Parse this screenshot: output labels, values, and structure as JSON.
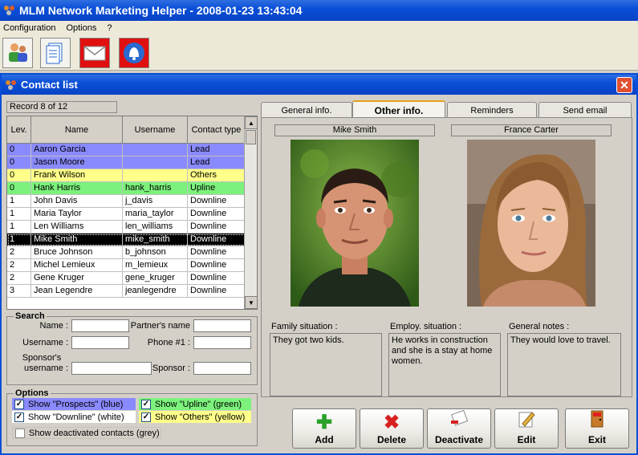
{
  "app": {
    "title": "MLM Network Marketing Helper - 2008-01-23 13:43:04"
  },
  "menu": [
    "Configuration",
    "Options",
    "?"
  ],
  "toolbar": {
    "buttons": [
      "contacts-icon",
      "document-icon",
      "email-icon",
      "alarm-bell-icon"
    ]
  },
  "contact_window": {
    "title": "Contact list",
    "record": "Record 8 of 12",
    "columns": [
      "Lev.",
      "Name",
      "Username",
      "Contact type"
    ],
    "rows": [
      {
        "lev": "0",
        "name": "Aaron Garcia",
        "username": "",
        "type": "Lead",
        "color": "blue"
      },
      {
        "lev": "0",
        "name": "Jason Moore",
        "username": "",
        "type": "Lead",
        "color": "blue"
      },
      {
        "lev": "0",
        "name": "Frank Wilson",
        "username": "",
        "type": "Others",
        "color": "yellow"
      },
      {
        "lev": "0",
        "name": "Hank Harris",
        "username": "hank_harris",
        "type": "Upline",
        "color": "green"
      },
      {
        "lev": "1",
        "name": "John Davis",
        "username": "j_davis",
        "type": "Downline",
        "color": "white"
      },
      {
        "lev": "1",
        "name": "Maria Taylor",
        "username": "maria_taylor",
        "type": "Downline",
        "color": "white"
      },
      {
        "lev": "1",
        "name": "Len Williams",
        "username": "len_williams",
        "type": "Downline",
        "color": "white"
      },
      {
        "lev": "1",
        "name": "Mike Smith",
        "username": "mike_smith",
        "type": "Downline",
        "color": "selected"
      },
      {
        "lev": "2",
        "name": "Bruce Johnson",
        "username": "b_johnson",
        "type": "Downline",
        "color": "white"
      },
      {
        "lev": "2",
        "name": "Michel Lemieux",
        "username": "m_lemieux",
        "type": "Downline",
        "color": "white"
      },
      {
        "lev": "2",
        "name": "Gene Kruger",
        "username": "gene_kruger",
        "type": "Downline",
        "color": "white"
      },
      {
        "lev": "3",
        "name": "Jean Legendre",
        "username": "jeanlegendre",
        "type": "Downline",
        "color": "white"
      }
    ],
    "search": {
      "title": "Search",
      "name": "Name :",
      "partners_name": "Partner's name",
      "username": "Username :",
      "phone": "Phone #1 :",
      "sponsors_username_1": "Sponsor's",
      "sponsors_username_2": "username :",
      "sponsor": "Sponsor :"
    },
    "options": {
      "title": "Options",
      "prospects": "Show \"Prospects\" (blue)",
      "upline": "Show \"Upline\" (green)",
      "downline": "Show \"Downline\" (white)",
      "others": "Show \"Others\" (yellow)",
      "deactivated": "Show deactivated contacts (grey)"
    },
    "tabs": [
      "General info.",
      "Other info.",
      "Reminders",
      "Send email"
    ],
    "person1": "Mike Smith",
    "person2": "France Carter",
    "family_label": "Family situation :",
    "family_text": "They got two kids.",
    "employ_label": "Employ. situation :",
    "employ_text": "He works in construction and she is a stay at home women.",
    "notes_label": "General notes :",
    "notes_text": "They would love to travel.",
    "actions": [
      "Add",
      "Delete",
      "Deactivate",
      "Edit",
      "Exit"
    ],
    "colors": {
      "blue": "#8a8aff",
      "green": "#7cf27c",
      "yellow": "#ffff8a",
      "title": "#0a4fd8"
    }
  }
}
